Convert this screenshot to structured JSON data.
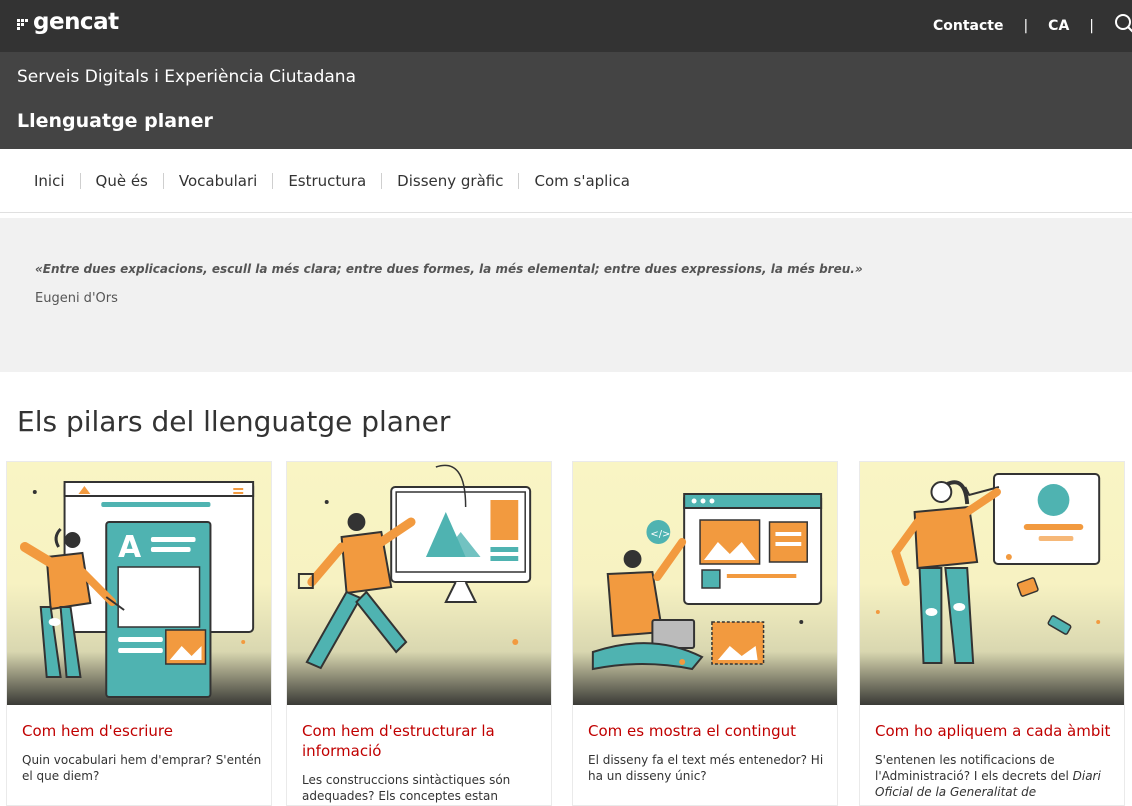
{
  "header": {
    "brand": "gencat",
    "links": [
      {
        "label": "Contacte"
      },
      {
        "label": "CA"
      }
    ]
  },
  "site": {
    "name": "Serveis Digitals i Experiència Ciutadana",
    "page": "Llenguatge planer"
  },
  "nav": {
    "items": [
      "Inici",
      "Què és",
      "Vocabulari",
      "Estructura",
      "Disseny gràfic",
      "Com s'aplica"
    ]
  },
  "quote": {
    "text": "«Entre dues explicacions, escull la més clara; entre dues formes, la més elemental; entre dues expressions, la més breu.»",
    "author": "Eugeni d'Ors"
  },
  "section": {
    "title": "Els pilars del llenguatge planer"
  },
  "cards": [
    {
      "title": "Com hem d'escriure",
      "description": "Quin vocabulari hem d'emprar? S'entén el que diem?"
    },
    {
      "title": "Com hem d'estructurar la informació",
      "description": "Les construccions sintàctiques són adequades? Els conceptes estan"
    },
    {
      "title": "Com es mostra el contingut",
      "description": "El disseny fa el text més entenedor? Hi ha un disseny únic?"
    },
    {
      "title": "Com ho apliquem a cada àmbit",
      "description_prefix": "S'entenen les notificacions de l'Administració? I els decrets del ",
      "description_italic": "Diari Oficial de la Generalitat de"
    }
  ],
  "colors": {
    "topbar": "#333333",
    "band": "#444444",
    "accent": "#c00000",
    "illustration_bg": "#f9f5c4",
    "orange": "#f29a3f",
    "teal": "#4fb3b1"
  }
}
